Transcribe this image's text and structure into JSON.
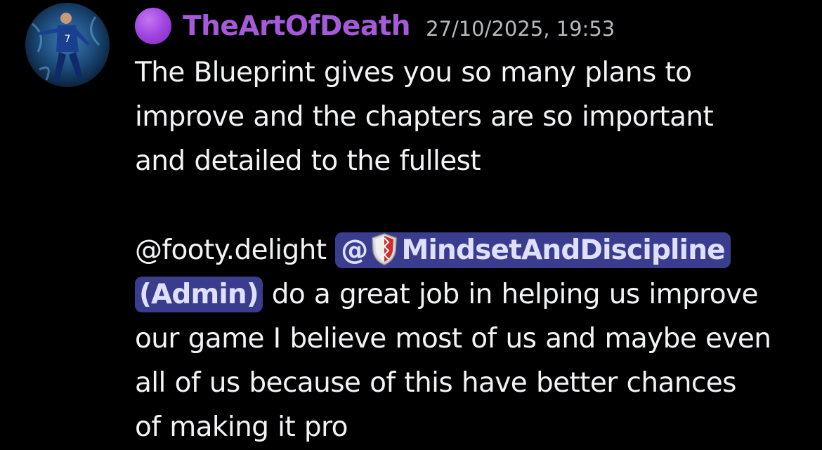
{
  "message": {
    "author": "TheArtOfDeath",
    "timestamp": "27/10/2025, 19:53",
    "colors": {
      "author": "#a55bd9",
      "role_dot": "#a548e3",
      "mention_bg": "#3a3d8e",
      "mention_text": "#dee0fc",
      "background": "#000000"
    },
    "paragraph1": [
      "The Blueprint gives you so many plans to",
      "improve and the chapters are so important",
      "and detailed to the fullest"
    ],
    "paragraph2": {
      "user_mention": "@footy.delight",
      "role_mention_at": "@",
      "role_mention_icon": "shield-icon",
      "role_mention_name": "MindsetAndDiscipline",
      "role_mention_suffix": "(Admin)",
      "line2_rest": " do a great job in helping us improve",
      "lines": [
        "our game I believe most of us and maybe even",
        "all of us because of this have better chances",
        "of making it pro"
      ]
    }
  }
}
